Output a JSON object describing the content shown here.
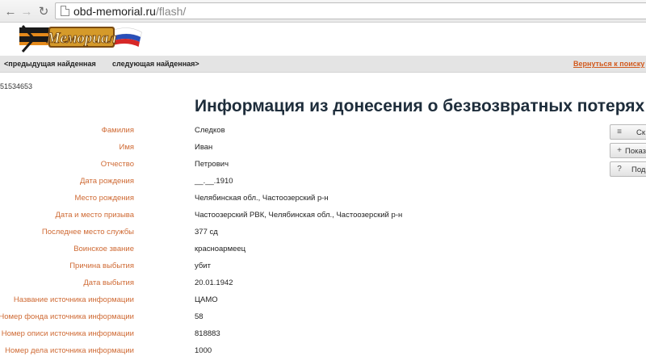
{
  "browser": {
    "url_domain": "obd-memorial.ru",
    "url_path": "/flash/"
  },
  "logo": {
    "text": "Мемориал"
  },
  "nav": {
    "prev": "<предыдущая найденная",
    "next": "следующая найденная>",
    "back": "Вернуться к поиску"
  },
  "record_id": "51534653",
  "title": "Информация из донесения о безвозвратных потерях",
  "fields": [
    {
      "label": "Фамилия",
      "value": "Следков"
    },
    {
      "label": "Имя",
      "value": "Иван"
    },
    {
      "label": "Отчество",
      "value": "Петрович"
    },
    {
      "label": "Дата рождения",
      "value": "__.__.1910"
    },
    {
      "label": "Место рождения",
      "value": "Челябинская обл., Частоозерский р-н"
    },
    {
      "label": "Дата и место призыва",
      "value": "Частоозерский РВК, Челябинская обл., Частоозерский р-н"
    },
    {
      "label": "Последнее место службы",
      "value": "377 сд"
    },
    {
      "label": "Воинское звание",
      "value": "красноармеец"
    },
    {
      "label": "Причина выбытия",
      "value": "убит"
    },
    {
      "label": "Дата выбытия",
      "value": "20.01.1942"
    },
    {
      "label": "Название источника информации",
      "value": "ЦАМО"
    },
    {
      "label": "Номер фонда источника информации",
      "value": "58"
    },
    {
      "label": "Номер описи источника информации",
      "value": "818883"
    },
    {
      "label": "Номер дела источника информации",
      "value": "1000"
    }
  ],
  "side_buttons": [
    {
      "icon": "≡",
      "label": "Ск"
    },
    {
      "icon": "+",
      "label": "Показ"
    },
    {
      "icon": "?",
      "label": "Под"
    }
  ],
  "colors": {
    "label": "#cf6a34",
    "title": "#1e2d3b",
    "link": "#d25a1e"
  }
}
